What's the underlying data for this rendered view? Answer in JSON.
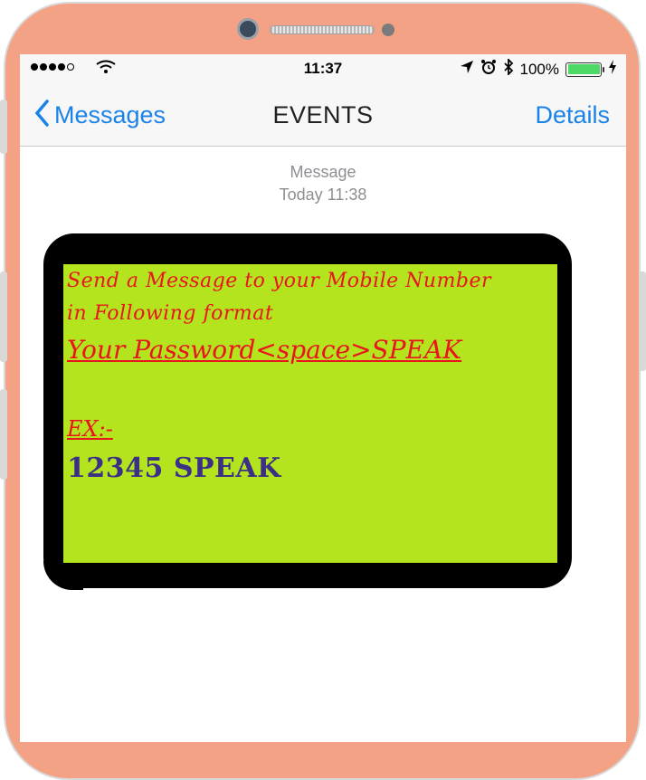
{
  "status_bar": {
    "time": "11:37",
    "battery_percent": "100%",
    "battery_level": 1.0,
    "signal_bars_filled": 4,
    "signal_bars_total": 5,
    "icons": [
      "signal-dots-icon",
      "wifi-icon",
      "location-arrow-icon",
      "alarm-icon",
      "bluetooth-icon",
      "battery-icon",
      "charging-bolt-icon"
    ]
  },
  "nav": {
    "back_label": "Messages",
    "title": "EVENTS",
    "details_label": "Details"
  },
  "conversation": {
    "meta_label": "Message",
    "timestamp": "Today 11:38"
  },
  "message": {
    "line1": "Send a Message to your Mobile Number",
    "line2": "in Following format",
    "format": "Your Password<space>SPEAK",
    "example_label": "EX:-",
    "example_value": "12345  SPEAK"
  },
  "colors": {
    "accent_blue": "#1a82e8",
    "phone_frame": "#f3a285",
    "card_green": "#b4e41e",
    "text_red": "#e8151f",
    "example_purple": "#3b2f86",
    "battery_green": "#4cd964"
  }
}
